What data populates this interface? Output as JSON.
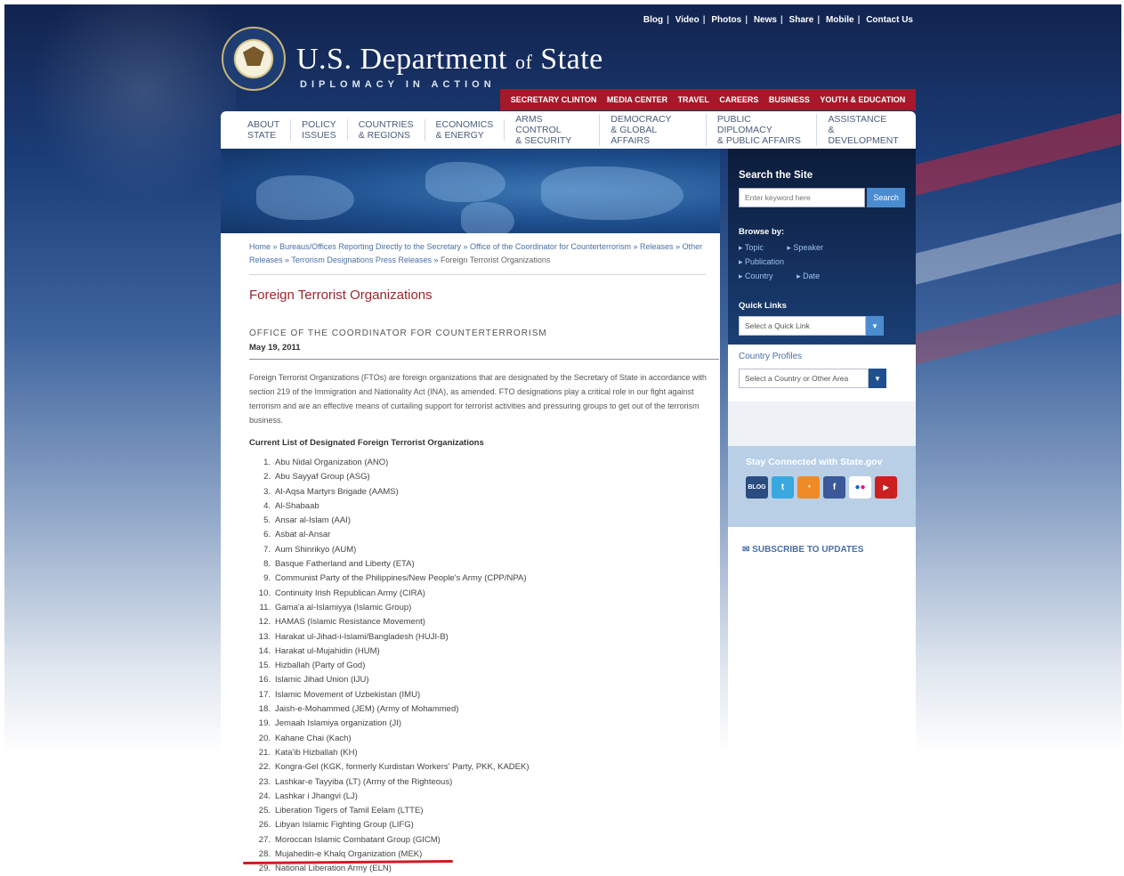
{
  "utility_links": [
    "Blog",
    "Video",
    "Photos",
    "News",
    "Share",
    "Mobile",
    "Contact Us"
  ],
  "site": {
    "title_main": "U.S. Department ",
    "title_of": "of",
    "title_end": " State",
    "tagline": "DIPLOMACY IN ACTION"
  },
  "red_nav": [
    "SECRETARY CLINTON",
    "MEDIA CENTER",
    "TRAVEL",
    "CAREERS",
    "BUSINESS",
    "YOUTH & EDUCATION"
  ],
  "main_nav": [
    "ABOUT\nSTATE",
    "POLICY\nISSUES",
    "COUNTRIES\n& REGIONS",
    "ECONOMICS\n& ENERGY",
    "ARMS CONTROL\n& SECURITY",
    "DEMOCRACY\n& GLOBAL AFFAIRS",
    "PUBLIC DIPLOMACY\n& PUBLIC AFFAIRS",
    "ASSISTANCE\n& DEVELOPMENT"
  ],
  "breadcrumb": {
    "items": [
      "Home",
      "Bureaus/Offices Reporting Directly to the Secretary",
      "Office of the Coordinator for Counterterrorism",
      "Releases",
      "Other Releases",
      "Terrorism Designations Press Releases"
    ],
    "current": "Foreign Terrorist Organizations",
    "separator": "»"
  },
  "page": {
    "title": "Foreign Terrorist Organizations",
    "office": "OFFICE OF THE COORDINATOR FOR COUNTERTERRORISM",
    "date": "May 19, 2011",
    "intro": "Foreign Terrorist Organizations (FTOs) are foreign organizations that are designated by the Secretary of State in accordance with section 219 of the Immigration and Nationality Act (INA), as amended. FTO designations play a critical role in our fight against terrorism and are an effective means of curtailing support for terrorist activities and pressuring groups to get out of the terrorism business.",
    "list_heading": "Current List of Designated Foreign Terrorist Organizations"
  },
  "fto_list": [
    "Abu Nidal Organization (ANO)",
    "Abu Sayyaf Group (ASG)",
    "Al-Aqsa Martyrs Brigade (AAMS)",
    "Al-Shabaab",
    "Ansar al-Islam (AAI)",
    "Asbat al-Ansar",
    "Aum Shinrikyo (AUM)",
    "Basque Fatherland and Liberty (ETA)",
    "Communist Party of the Philippines/New People's Army (CPP/NPA)",
    "Continuity Irish Republican Army (CIRA)",
    "Gama'a al-Islamiyya (Islamic Group)",
    "HAMAS (Islamic Resistance Movement)",
    "Harakat ul-Jihad-i-Islami/Bangladesh (HUJI-B)",
    "Harakat ul-Mujahidin (HUM)",
    "Hizballah (Party of God)",
    "Islamic Jihad Union (IJU)",
    "Islamic Movement of Uzbekistan (IMU)",
    "Jaish-e-Mohammed (JEM) (Army of Mohammed)",
    "Jemaah Islamiya organization (JI)",
    "Kahane Chai (Kach)",
    "Kata'ib Hizballah (KH)",
    "Kongra-Gel (KGK, formerly Kurdistan Workers' Party, PKK, KADEK)",
    "Lashkar-e Tayyiba (LT) (Army of the Righteous)",
    "Lashkar i Jhangvi (LJ)",
    "Liberation Tigers of Tamil Eelam (LTTE)",
    "Libyan Islamic Fighting Group (LIFG)",
    "Moroccan Islamic Combatant Group (GICM)",
    "Mujahedin-e Khalq Organization (MEK)",
    "National Liberation Army (ELN)"
  ],
  "sidebar": {
    "search_title": "Search the Site",
    "search_placeholder": "Enter keyword here",
    "search_button": "Search",
    "browse_title": "Browse by:",
    "browse_links": [
      "Topic",
      "Speaker",
      "Publication",
      "Country",
      "Date"
    ],
    "quick_links_title": "Quick Links",
    "quick_links_select": "Select a Quick Link",
    "country_title": "Country Profiles",
    "country_select": "Select a Country or Other Area",
    "connected_title": "Stay Connected with State.gov",
    "social_icons": [
      "dipnote-blog-icon",
      "twitter-icon",
      "rss-icon",
      "facebook-icon",
      "flickr-icon",
      "youtube-icon"
    ],
    "subscribe": "SUBSCRIBE TO UPDATES"
  },
  "colors": {
    "accent_red": "#a5192a",
    "link_blue": "#4a6fa5",
    "highlight_underline": "#d21a24"
  }
}
